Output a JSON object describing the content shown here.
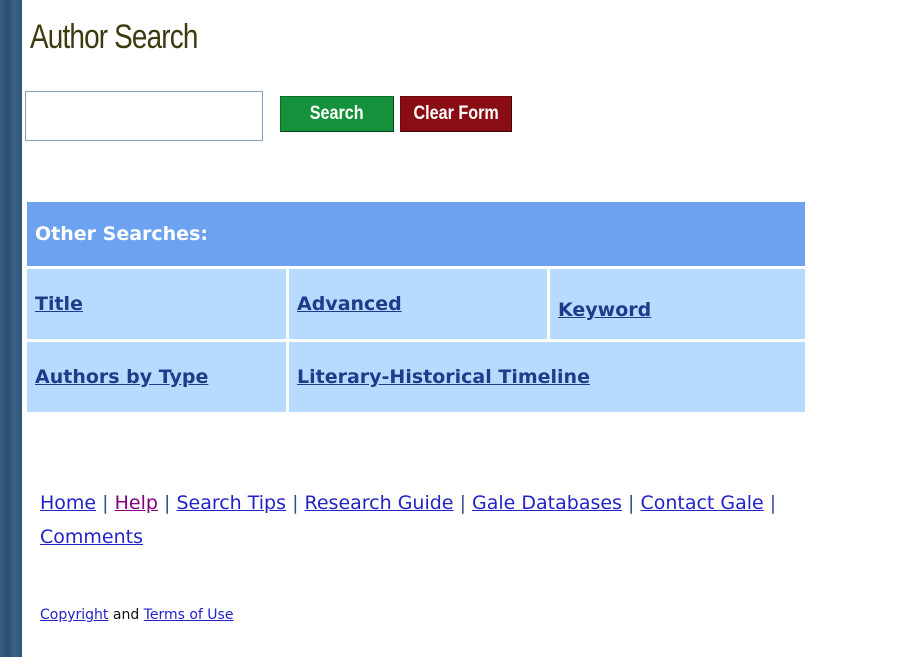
{
  "page": {
    "title": "Author Search"
  },
  "search": {
    "input_value": "",
    "search_label": "Search",
    "clear_label": "Clear Form"
  },
  "other_searches": {
    "header": "Other Searches:",
    "links": {
      "title": "Title",
      "advanced": "Advanced",
      "keyword": "Keyword",
      "authors_by_type": "Authors by Type",
      "timeline": "Literary-Historical Timeline"
    }
  },
  "footer": {
    "separator": "|",
    "links": {
      "home": "Home",
      "help": "Help",
      "search_tips": "Search Tips",
      "research_guide": "Research Guide",
      "gale_databases": "Gale Databases",
      "contact_gale": "Contact Gale",
      "comments": "Comments"
    },
    "copyright": "Copyright",
    "and_text": "and",
    "terms": "Terms of Use"
  },
  "colors": {
    "search_button": "#14913a",
    "clear_button": "#8a0c14",
    "table_header": "#6ca2f0",
    "table_cell": "#b7dbff",
    "visited_link": "#800080"
  }
}
